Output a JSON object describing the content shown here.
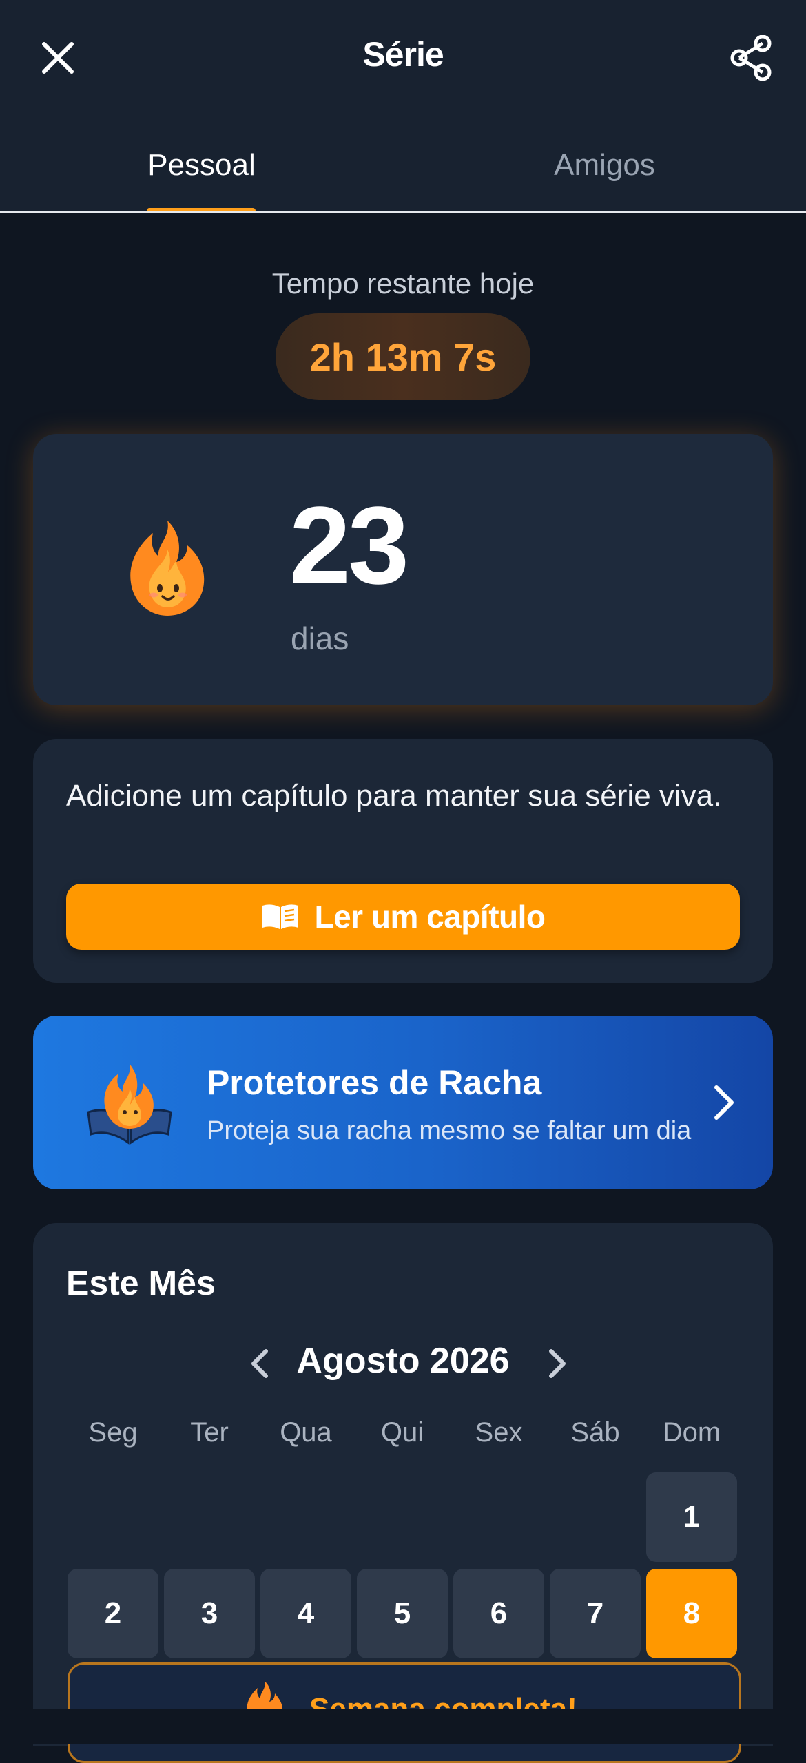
{
  "header": {
    "title": "Série"
  },
  "tabs": [
    {
      "label": "Pessoal",
      "active": true
    },
    {
      "label": "Amigos",
      "active": false
    }
  ],
  "timer": {
    "label": "Tempo restante hoje",
    "value": "2h 13m 7s"
  },
  "streak": {
    "count": "23",
    "unit": "dias"
  },
  "action": {
    "text": "Adicione um capítulo para manter sua série viva.",
    "button_label": "Ler um capítulo"
  },
  "protectors": {
    "title": "Protetores de Racha",
    "subtitle": "Proteja sua racha mesmo se faltar um dia"
  },
  "month": {
    "title": "Este Mês",
    "label": "Agosto 2026",
    "weekdays": [
      "Seg",
      "Ter",
      "Qua",
      "Qui",
      "Sex",
      "Sáb",
      "Dom"
    ],
    "days": [
      "1",
      "2",
      "3",
      "4",
      "5",
      "6",
      "7",
      "8"
    ],
    "today": "8",
    "week_complete": "Semana completa!"
  },
  "colors": {
    "accent": "#ff9800",
    "background": "#0f1621",
    "card": "#1c2737",
    "protect_blue": "#1a63c9"
  },
  "icons": [
    "close-icon",
    "share-icon",
    "flame-icon",
    "book-icon",
    "chevron-right-icon",
    "chevron-left-icon"
  ]
}
